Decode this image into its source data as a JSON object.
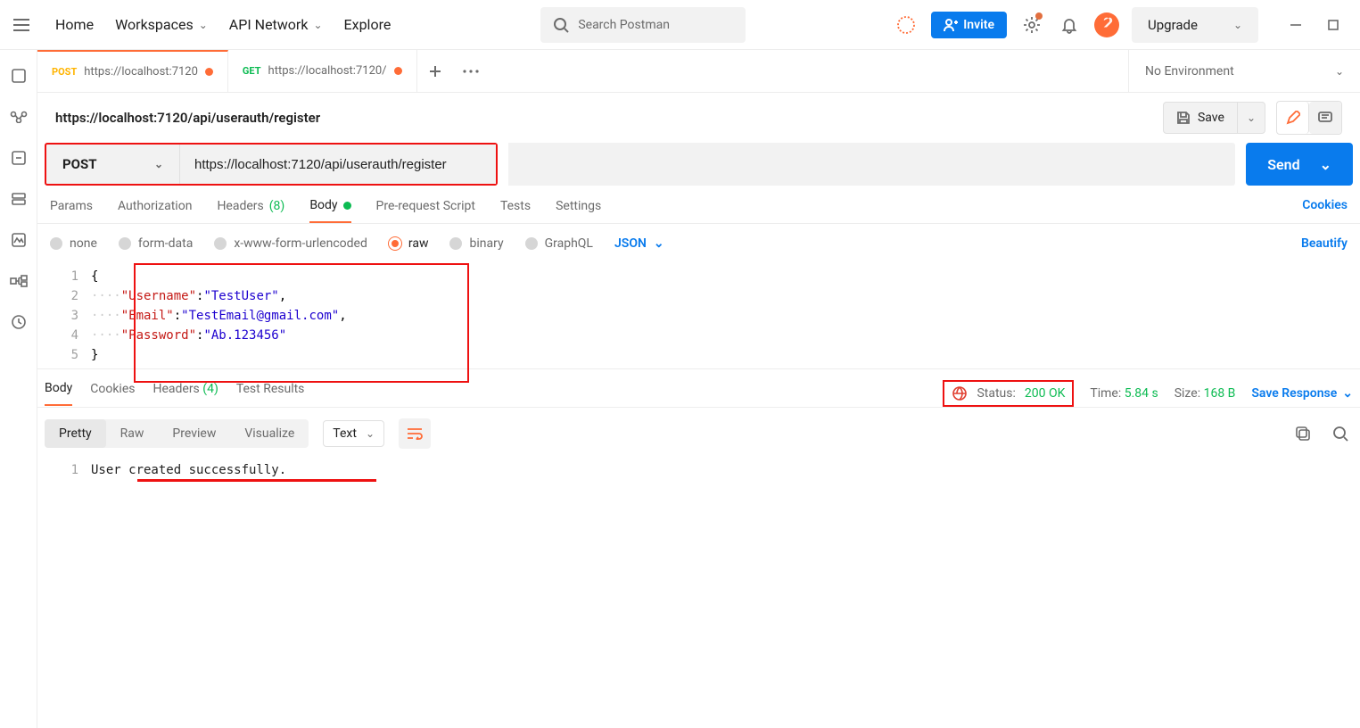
{
  "topnav": {
    "home": "Home",
    "workspaces": "Workspaces",
    "api_network": "API Network",
    "explore": "Explore",
    "search_placeholder": "Search Postman",
    "invite": "Invite",
    "upgrade": "Upgrade"
  },
  "tabs": [
    {
      "method": "POST",
      "method_class": "post",
      "url": "https://localhost:7120",
      "dirty": true,
      "active": true
    },
    {
      "method": "GET",
      "method_class": "get",
      "url": "https://localhost:7120/",
      "dirty": true,
      "active": false
    }
  ],
  "environment": "No Environment",
  "request": {
    "title": "https://localhost:7120/api/userauth/register",
    "save_label": "Save",
    "method": "POST",
    "url": "https://localhost:7120/api/userauth/register",
    "send_label": "Send",
    "sub_tabs": {
      "params": "Params",
      "authorization": "Authorization",
      "headers": "Headers",
      "headers_count": "(8)",
      "body": "Body",
      "pre_request": "Pre-request Script",
      "tests": "Tests",
      "settings": "Settings",
      "cookies": "Cookies"
    },
    "body_types": {
      "none": "none",
      "form_data": "form-data",
      "urlenc": "x-www-form-urlencoded",
      "raw": "raw",
      "binary": "binary",
      "graphql": "GraphQL",
      "json": "JSON",
      "beautify": "Beautify"
    },
    "body_lines": {
      "l1": "{",
      "l2_key": "\"Username\"",
      "l2_val": "\"TestUser\"",
      "l3_key": "\"Email\"",
      "l3_val": "\"TestEmail@gmail.com\"",
      "l4_key": "\"Password\"",
      "l4_val": "\"Ab.123456\"",
      "l5": "}"
    }
  },
  "response": {
    "tabs": {
      "body": "Body",
      "cookies": "Cookies",
      "headers": "Headers",
      "headers_count": "(4)",
      "test_results": "Test Results"
    },
    "status_label": "Status:",
    "status_value": "200 OK",
    "time_label": "Time:",
    "time_value": "5.84 s",
    "size_label": "Size:",
    "size_value": "168 B",
    "save_response": "Save Response",
    "formats": {
      "pretty": "Pretty",
      "raw": "Raw",
      "preview": "Preview",
      "visualize": "Visualize",
      "text": "Text"
    },
    "body_text": "User created successfully."
  }
}
